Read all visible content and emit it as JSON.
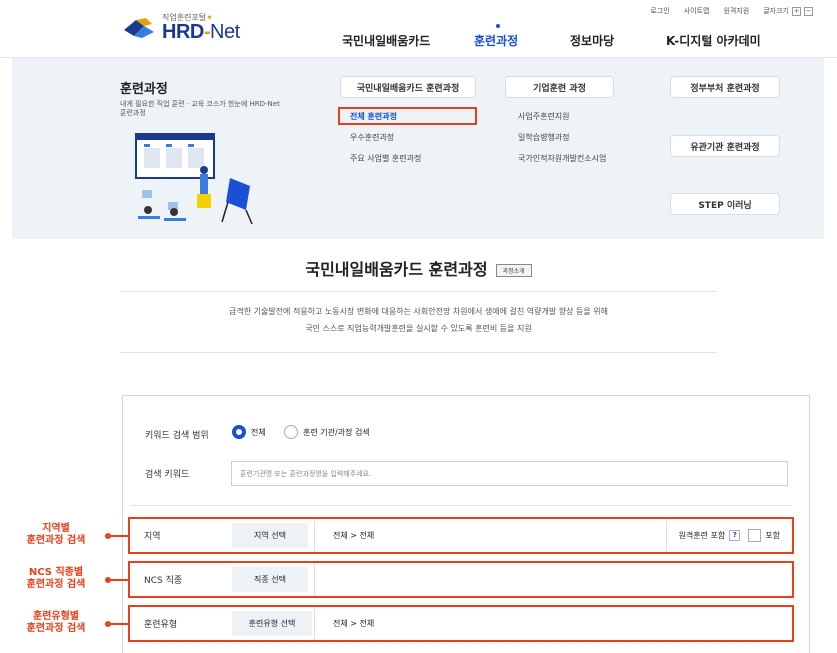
{
  "util": {
    "login": "로그인",
    "sitemap": "사이트맵",
    "remote": "원격지원",
    "fontsize": "글자크기",
    "plus": "+",
    "minus": "−"
  },
  "logo": {
    "sub": "직업훈련포털",
    "star": "✦",
    "hrd": "HRD",
    "dash": "-",
    "net": "Net"
  },
  "gnb": {
    "card": "국민내일배움카드",
    "course": "훈련과정",
    "info": "정보마당",
    "kdigital": "K-디지털 아카데미"
  },
  "mega": {
    "title": "훈련과정",
    "desc": "내게 필요한 직업 훈련 · 교육 코스가 한눈에 HRD-Net 훈련과정",
    "cat_card": "국민내일배움카드 훈련과정",
    "cat_corp": "기업훈련 과정",
    "cat_gov": "정부부처 훈련과정",
    "cat_inst": "유관기관 훈련과정",
    "cat_step": "STEP 이러닝",
    "card_items": [
      "전체 훈련과정",
      "우수훈련과정",
      "주요 사업별 훈련과정"
    ],
    "corp_items": [
      "사업주훈련지원",
      "일학습병행과정",
      "국가인적자원개발컨소시엄"
    ]
  },
  "main": {
    "title": "국민내일배움카드 훈련과정",
    "tag": "과정소개",
    "lead1": "급격한 기술발전에 적응하고 노동시장 변화에 대응하는 사회안전망 차원에서 생애에 걸친 역량개발 향상 등을 위해",
    "lead2": "국민 스스로 직업능력개발훈련을 실시할 수 있도록 훈련비 등을 지원"
  },
  "search": {
    "scope_label": "키워드 검색 범위",
    "scope_all": "전체",
    "scope_inst": "훈련 기관/과정 검색",
    "kw_label": "검색 키워드",
    "kw_placeholder": "훈련기관명 또는 훈련과정명을 입력해주세요.",
    "region_label": "지역",
    "region_btn": "지역 선택",
    "region_val": "전체 > 전체",
    "remote_label": "원격훈련 포함",
    "remote_help": "?",
    "remote_chk": "포함",
    "ncs_label": "NCS 직종",
    "ncs_btn": "직종 선택",
    "type_label": "훈련유형",
    "type_btn": "훈련유형 선택",
    "type_val": "전체 > 전체"
  },
  "callouts": {
    "region_1": "지역별",
    "region_2": "훈련과정 검색",
    "ncs_1": "NCS 직종별",
    "ncs_2": "훈련과정 검색",
    "type_1": "훈련유형별",
    "type_2": "훈련과정 검색"
  },
  "colors": {
    "accent": "#1a4fd6",
    "highlight": "#e8401c",
    "panel": "#eef3f8"
  },
  "icons": [
    "logo-mark-icon",
    "illustration",
    "radio-icon",
    "help-icon",
    "checkbox-icon"
  ]
}
